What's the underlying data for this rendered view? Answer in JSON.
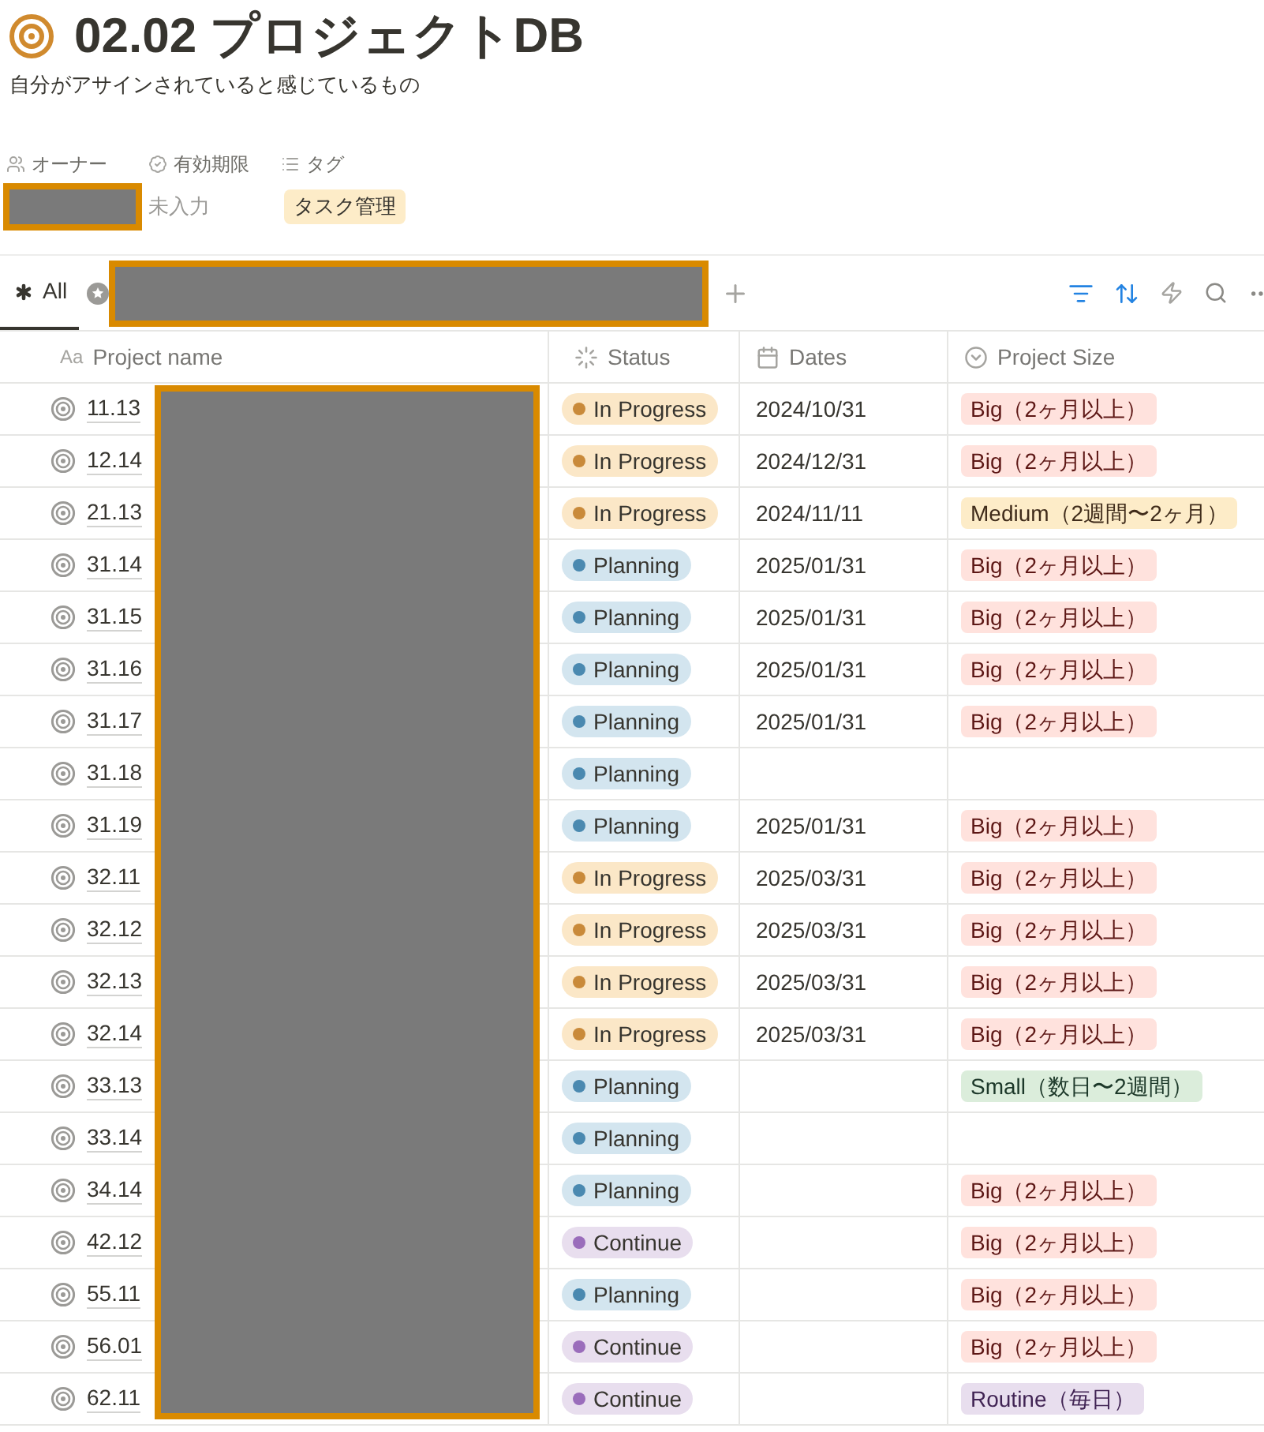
{
  "title": "02.02 プロジェクトDB",
  "description": "自分がアサインされていると感じているもの",
  "properties": [
    {
      "kind": "person",
      "label": "オーナー",
      "redacted": true
    },
    {
      "kind": "verified",
      "label": "有効期限",
      "value": "未入力"
    },
    {
      "kind": "tags",
      "label": "タグ",
      "tag": "タスク管理"
    }
  ],
  "views": [
    {
      "label": "All",
      "selected": true,
      "kind": "all"
    },
    {
      "kind": "redacted",
      "selected": false
    }
  ],
  "table": {
    "title_column_icon": "Aa",
    "columns": [
      "Project name",
      "Status",
      "Dates",
      "Project Size"
    ],
    "rows": [
      {
        "name": "11.13",
        "status": {
          "label": "In Progress",
          "kind": "progress"
        },
        "date": "2024/10/31",
        "size": {
          "label": "Big（2ヶ月以上）",
          "kind": "big"
        }
      },
      {
        "name": "12.14",
        "status": {
          "label": "In Progress",
          "kind": "progress"
        },
        "date": "2024/12/31",
        "size": {
          "label": "Big（2ヶ月以上）",
          "kind": "big"
        }
      },
      {
        "name": "21.13",
        "status": {
          "label": "In Progress",
          "kind": "progress"
        },
        "date": "2024/11/11",
        "size": {
          "label": "Medium（2週間〜2ヶ月）",
          "kind": "medium"
        }
      },
      {
        "name": "31.14",
        "status": {
          "label": "Planning",
          "kind": "planning"
        },
        "date": "2025/01/31",
        "size": {
          "label": "Big（2ヶ月以上）",
          "kind": "big"
        }
      },
      {
        "name": "31.15",
        "status": {
          "label": "Planning",
          "kind": "planning"
        },
        "date": "2025/01/31",
        "size": {
          "label": "Big（2ヶ月以上）",
          "kind": "big"
        }
      },
      {
        "name": "31.16",
        "status": {
          "label": "Planning",
          "kind": "planning"
        },
        "date": "2025/01/31",
        "size": {
          "label": "Big（2ヶ月以上）",
          "kind": "big"
        }
      },
      {
        "name": "31.17",
        "status": {
          "label": "Planning",
          "kind": "planning"
        },
        "date": "2025/01/31",
        "size": {
          "label": "Big（2ヶ月以上）",
          "kind": "big"
        }
      },
      {
        "name": "31.18",
        "status": {
          "label": "Planning",
          "kind": "planning"
        }
      },
      {
        "name": "31.19",
        "status": {
          "label": "Planning",
          "kind": "planning"
        },
        "date": "2025/01/31",
        "size": {
          "label": "Big（2ヶ月以上）",
          "kind": "big"
        }
      },
      {
        "name": "32.11",
        "status": {
          "label": "In Progress",
          "kind": "progress"
        },
        "date": "2025/03/31",
        "size": {
          "label": "Big（2ヶ月以上）",
          "kind": "big"
        }
      },
      {
        "name": "32.12",
        "status": {
          "label": "In Progress",
          "kind": "progress"
        },
        "date": "2025/03/31",
        "size": {
          "label": "Big（2ヶ月以上）",
          "kind": "big"
        }
      },
      {
        "name": "32.13",
        "status": {
          "label": "In Progress",
          "kind": "progress"
        },
        "date": "2025/03/31",
        "size": {
          "label": "Big（2ヶ月以上）",
          "kind": "big"
        }
      },
      {
        "name": "32.14",
        "status": {
          "label": "In Progress",
          "kind": "progress"
        },
        "date": "2025/03/31",
        "size": {
          "label": "Big（2ヶ月以上）",
          "kind": "big"
        }
      },
      {
        "name": "33.13",
        "status": {
          "label": "Planning",
          "kind": "planning"
        },
        "size": {
          "label": "Small（数日〜2週間）",
          "kind": "small"
        }
      },
      {
        "name": "33.14",
        "status": {
          "label": "Planning",
          "kind": "planning"
        }
      },
      {
        "name": "34.14",
        "status": {
          "label": "Planning",
          "kind": "planning"
        },
        "size": {
          "label": "Big（2ヶ月以上）",
          "kind": "big"
        }
      },
      {
        "name": "42.12",
        "status": {
          "label": "Continue",
          "kind": "continue"
        },
        "size": {
          "label": "Big（2ヶ月以上）",
          "kind": "big"
        }
      },
      {
        "name": "55.11",
        "status": {
          "label": "Planning",
          "kind": "planning"
        },
        "size": {
          "label": "Big（2ヶ月以上）",
          "kind": "big"
        }
      },
      {
        "name": "56.01",
        "status": {
          "label": "Continue",
          "kind": "continue"
        },
        "size": {
          "label": "Big（2ヶ月以上）",
          "kind": "big"
        }
      },
      {
        "name": "62.11",
        "status": {
          "label": "Continue",
          "kind": "continue"
        },
        "size": {
          "label": "Routine（毎日）",
          "kind": "routine"
        }
      }
    ]
  }
}
